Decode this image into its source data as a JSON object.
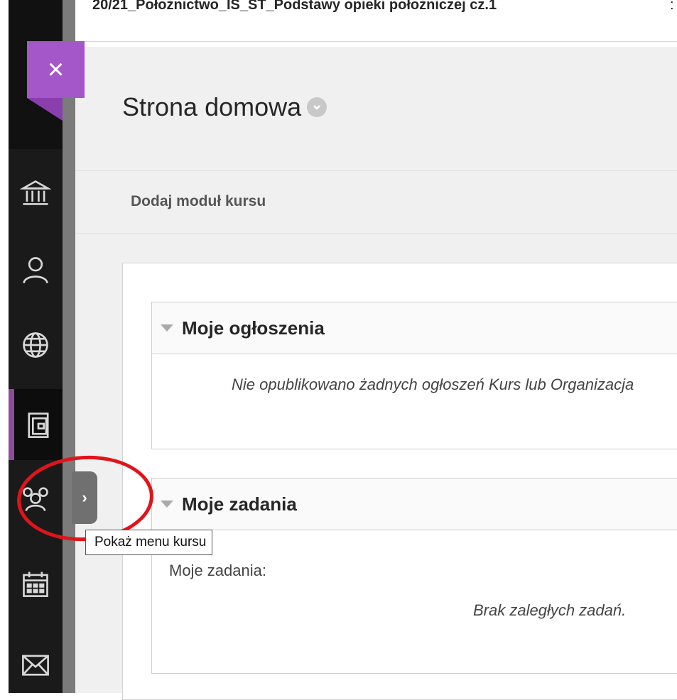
{
  "header": {
    "course_title": "20/21_Położnictwo_IS_ST_Podstawy opieki położniczej cz.1",
    "extra": ":"
  },
  "nav": {
    "close_label": "×",
    "items": [
      {
        "icon": "institution-icon"
      },
      {
        "icon": "user-icon"
      },
      {
        "icon": "globe-icon"
      },
      {
        "icon": "courses-icon",
        "active": true
      },
      {
        "icon": "groups-icon"
      },
      {
        "icon": "calendar-icon"
      },
      {
        "icon": "mail-icon"
      }
    ],
    "accent_color": "#a457c8"
  },
  "page": {
    "title": "Strona domowa",
    "add_module": "Dodaj moduł kursu"
  },
  "modules": {
    "announcements": {
      "title": "Moje ogłoszenia",
      "empty_message": "Nie opublikowano żadnych ogłoszeń Kurs lub Organizacja"
    },
    "tasks": {
      "title": "Moje zadania",
      "label": "Moje zadania:",
      "empty_message": "Brak zaległych zadań."
    }
  },
  "course_menu": {
    "expand_label": "›",
    "tooltip": "Pokaż menu kursu"
  }
}
